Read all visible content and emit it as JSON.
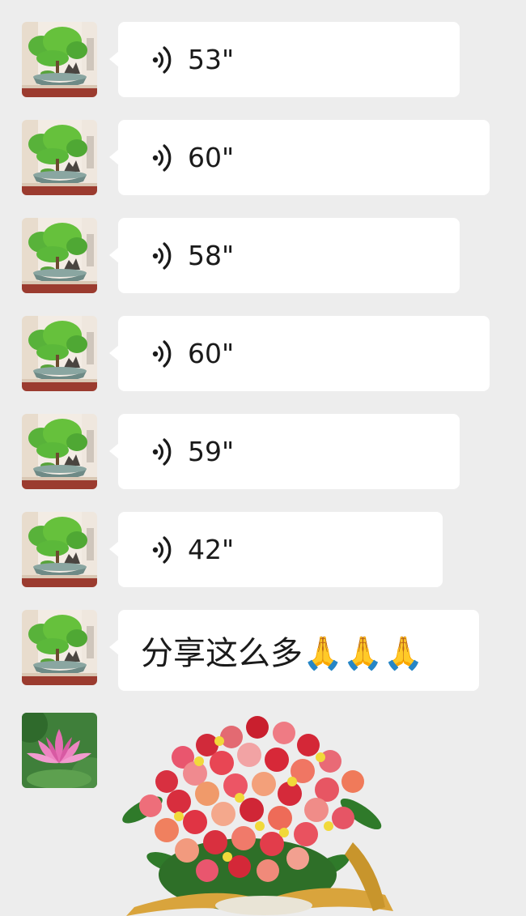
{
  "messages": [
    {
      "type": "voice",
      "duration": "53\"",
      "avatar": "bonsai-avatar"
    },
    {
      "type": "voice",
      "duration": "60\"",
      "avatar": "bonsai-avatar"
    },
    {
      "type": "voice",
      "duration": "58\"",
      "avatar": "bonsai-avatar"
    },
    {
      "type": "voice",
      "duration": "60\"",
      "avatar": "bonsai-avatar"
    },
    {
      "type": "voice",
      "duration": "59\"",
      "avatar": "bonsai-avatar"
    },
    {
      "type": "voice",
      "duration": "42\"",
      "avatar": "bonsai-avatar"
    },
    {
      "type": "text",
      "text": "分享这么多🙏🙏🙏",
      "avatar": "bonsai-avatar"
    },
    {
      "type": "sticker",
      "sticker": "rose-bouquet-sticker",
      "avatar": "lotus-avatar"
    }
  ],
  "colors": {
    "background": "#ededed",
    "bubble": "#ffffff",
    "text": "#1a1a1a"
  }
}
